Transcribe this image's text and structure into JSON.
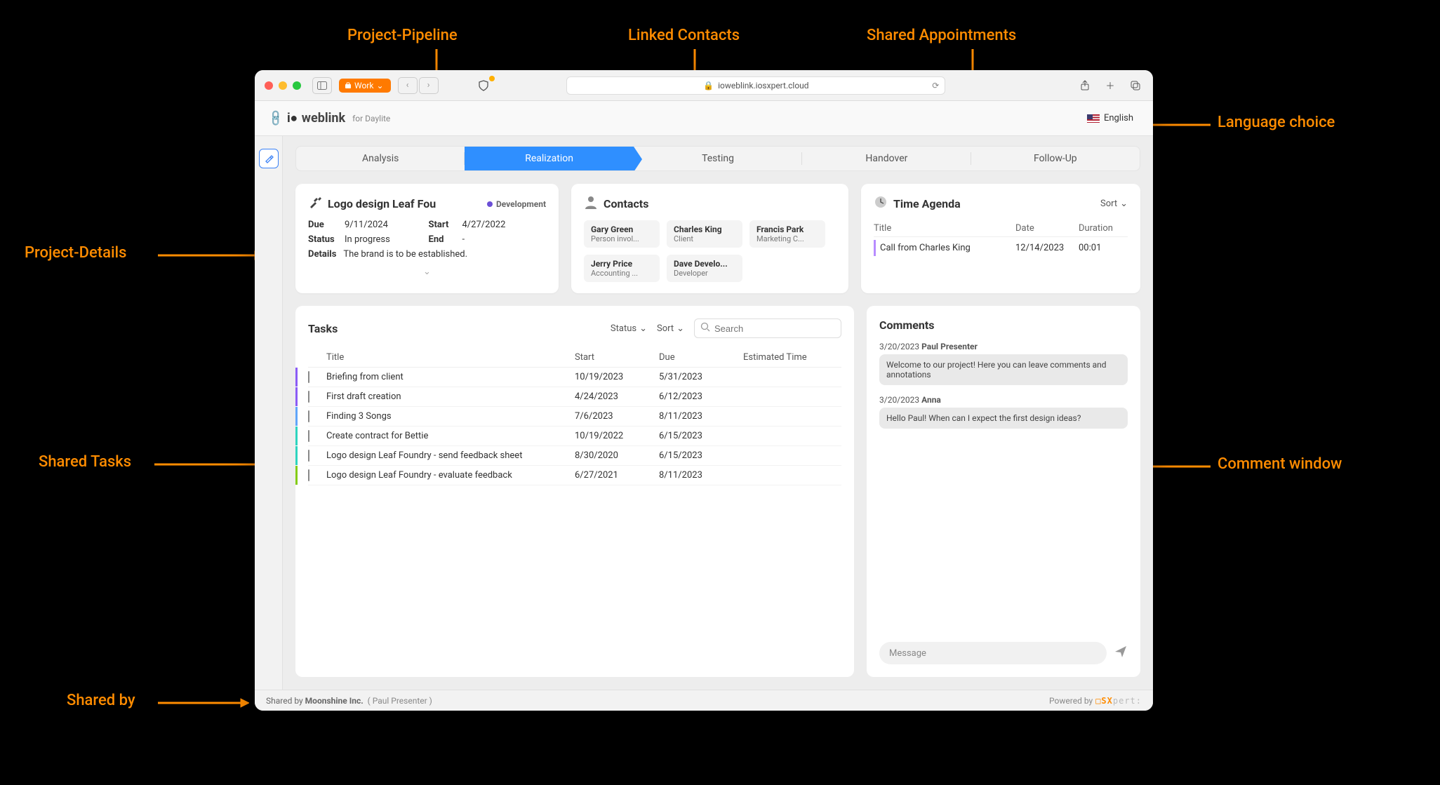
{
  "annotations": {
    "pipeline": "Project-Pipeline",
    "contacts": "Linked Contacts",
    "appointments": "Shared Appointments",
    "language": "Language choice",
    "details": "Project-Details",
    "tasks": "Shared Tasks",
    "comments_win": "Comment window",
    "shared_by": "Shared by"
  },
  "browser": {
    "tab_label": "Work",
    "url": "ioweblink.iosxpert.cloud"
  },
  "app": {
    "brand": "weblink",
    "brand_sub": "for Daylite",
    "language": "English"
  },
  "pipeline": {
    "stages": [
      "Analysis",
      "Realization",
      "Testing",
      "Handover",
      "Follow-Up"
    ],
    "active_index": 1
  },
  "project": {
    "title": "Logo design Leaf Fou",
    "badge": "Development",
    "due_label": "Due",
    "due": "9/11/2024",
    "start_label": "Start",
    "start": "4/27/2022",
    "status_label": "Status",
    "status": "In progress",
    "end_label": "End",
    "end": "-",
    "details_label": "Details",
    "details": "The brand is to be established."
  },
  "contacts": {
    "title": "Contacts",
    "items": [
      {
        "name": "Gary Green",
        "role": "Person invol..."
      },
      {
        "name": "Charles King",
        "role": "Client"
      },
      {
        "name": "Francis Park",
        "role": "Marketing C..."
      },
      {
        "name": "Jerry Price",
        "role": "Accounting ..."
      },
      {
        "name": "Dave Develo...",
        "role": "Developer"
      }
    ]
  },
  "agenda": {
    "title": "Time Agenda",
    "sort_label": "Sort",
    "cols": {
      "title": "Title",
      "date": "Date",
      "duration": "Duration"
    },
    "rows": [
      {
        "title": "Call from Charles King",
        "date": "12/14/2023",
        "duration": "00:01"
      }
    ]
  },
  "tasks": {
    "title": "Tasks",
    "status_label": "Status",
    "sort_label": "Sort",
    "search_placeholder": "Search",
    "cols": {
      "title": "Title",
      "start": "Start",
      "due": "Due",
      "est": "Estimated Time"
    },
    "items": [
      {
        "color": "purple",
        "title": "Briefing from client",
        "start": "10/19/2023",
        "due": "5/31/2023",
        "est": ""
      },
      {
        "color": "purple",
        "title": "First draft creation",
        "start": "4/24/2023",
        "due": "6/12/2023",
        "est": ""
      },
      {
        "color": "blue",
        "title": "Finding 3 Songs",
        "start": "7/6/2023",
        "due": "8/11/2023",
        "est": ""
      },
      {
        "color": "teal",
        "title": "Create contract for Bettie",
        "start": "10/19/2022",
        "due": "6/15/2023",
        "est": ""
      },
      {
        "color": "teal",
        "title": "Logo design Leaf Foundry - send feedback sheet",
        "start": "8/30/2020",
        "due": "6/15/2023",
        "est": ""
      },
      {
        "color": "green",
        "title": "Logo design Leaf Foundry - evaluate feedback",
        "start": "6/27/2021",
        "due": "8/11/2023",
        "est": ""
      }
    ]
  },
  "comments": {
    "title": "Comments",
    "items": [
      {
        "date": "3/20/2023",
        "author": "Paul Presenter",
        "text": "Welcome to our project! Here you can leave comments and annotations"
      },
      {
        "date": "3/20/2023",
        "author": "Anna",
        "text": "Hello Paul! When can I expect the first design ideas?"
      }
    ],
    "message_placeholder": "Message"
  },
  "footer": {
    "shared_by_label": "Shared by",
    "company": "Moonshine Inc.",
    "user": "( Paul Presenter )",
    "powered_by": "Powered by"
  }
}
